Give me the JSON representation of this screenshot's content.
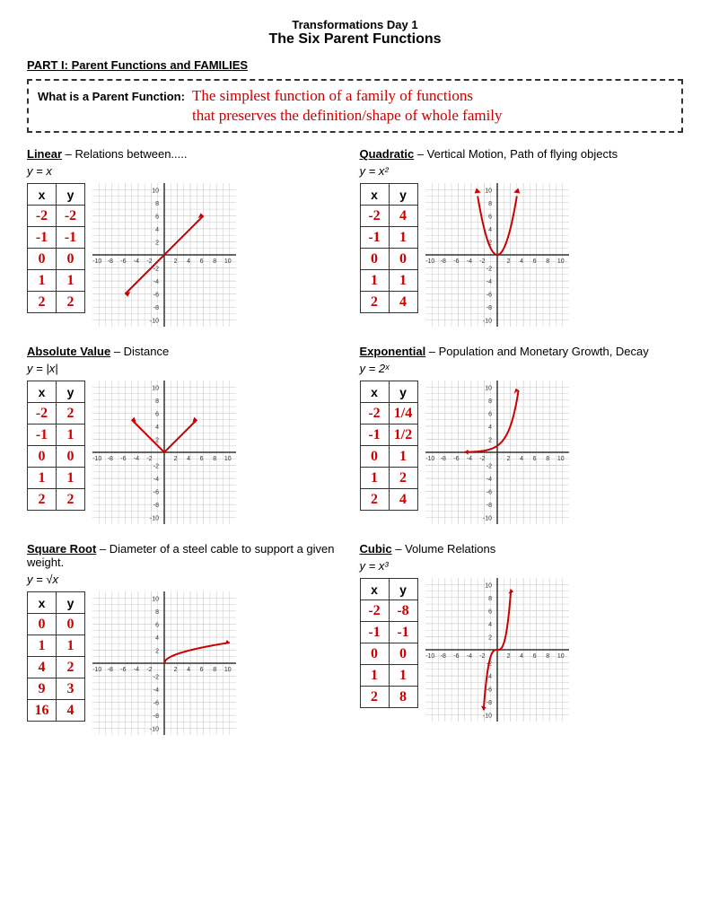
{
  "header": {
    "day": "Transformations Day 1",
    "title": "The Six Parent Functions"
  },
  "part1": {
    "heading": "PART I: Parent Functions and FAMILIES",
    "what_label": "What is a Parent Function:",
    "what_answer_line1": "The simplest function of a family of functions",
    "what_answer_line2": "that preserves the definition/shape of whole family"
  },
  "functions": [
    {
      "name": "Linear",
      "description": "Relations between.....",
      "equation": "y = x",
      "table": {
        "headers": [
          "x",
          "y"
        ],
        "rows": [
          [
            "-2",
            "-2"
          ],
          [
            "-1",
            "-1"
          ],
          [
            "0",
            "0"
          ],
          [
            "1",
            "1"
          ],
          [
            "2",
            "2"
          ]
        ]
      },
      "graph_type": "linear"
    },
    {
      "name": "Quadratic",
      "description": "Vertical Motion, Path of flying objects",
      "equation": "y = x²",
      "table": {
        "headers": [
          "x",
          "y"
        ],
        "rows": [
          [
            "-2",
            "4"
          ],
          [
            "-1",
            "1"
          ],
          [
            "0",
            "0"
          ],
          [
            "1",
            "1"
          ],
          [
            "2",
            "4"
          ]
        ]
      },
      "graph_type": "quadratic"
    },
    {
      "name": "Absolute Value",
      "description": "Distance",
      "equation": "y = |x|",
      "table": {
        "headers": [
          "x",
          "y"
        ],
        "rows": [
          [
            "-2",
            "2"
          ],
          [
            "-1",
            "1"
          ],
          [
            "0",
            "0"
          ],
          [
            "1",
            "1"
          ],
          [
            "2",
            "2"
          ]
        ]
      },
      "graph_type": "absolute"
    },
    {
      "name": "Exponential",
      "description": "Population and Monetary Growth, Decay",
      "equation": "y = 2ˣ",
      "table": {
        "headers": [
          "x",
          "y"
        ],
        "rows": [
          [
            "-2",
            "1/4"
          ],
          [
            "-1",
            "1/2"
          ],
          [
            "0",
            "1"
          ],
          [
            "1",
            "2"
          ],
          [
            "2",
            "4"
          ]
        ]
      },
      "graph_type": "exponential"
    },
    {
      "name": "Square Root",
      "description": "Diameter of a steel cable to support a given weight.",
      "equation": "y = √x",
      "table": {
        "headers": [
          "x",
          "y"
        ],
        "rows": [
          [
            "0",
            "0"
          ],
          [
            "1",
            "1"
          ],
          [
            "4",
            "2"
          ],
          [
            "9",
            "3"
          ],
          [
            "16",
            "4"
          ]
        ]
      },
      "graph_type": "sqrt"
    },
    {
      "name": "Cubic",
      "description": "Volume Relations",
      "equation": "y = x³",
      "table": {
        "headers": [
          "x",
          "y"
        ],
        "rows": [
          [
            "-2",
            "-8"
          ],
          [
            "-1",
            "-1"
          ],
          [
            "0",
            "0"
          ],
          [
            "1",
            "1"
          ],
          [
            "2",
            "8"
          ]
        ]
      },
      "graph_type": "cubic"
    }
  ]
}
